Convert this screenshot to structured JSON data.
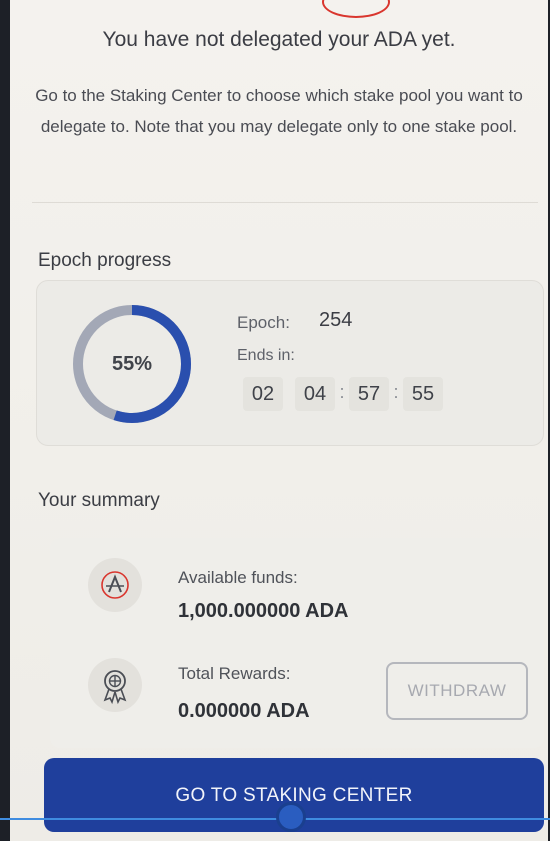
{
  "notice": {
    "title": "You have not delegated your ADA yet.",
    "body": "Go to the Staking Center to choose which stake pool you want to delegate to. Note that you may delegate only to one stake pool."
  },
  "epoch_progress": {
    "title": "Epoch progress",
    "percent_label": "55%",
    "percent_value": 55,
    "epoch_label": "Epoch:",
    "epoch_value": "254",
    "ends_label": "Ends in:",
    "countdown": [
      "02",
      "04",
      "57",
      "55"
    ],
    "separator": ":"
  },
  "summary": {
    "title": "Your summary",
    "available_label": "Available funds:",
    "available_value": "1,000.000000 ADA",
    "rewards_label": "Total Rewards:",
    "rewards_value": "0.000000 ADA",
    "withdraw_label": "WITHDRAW"
  },
  "staking_button": "GO TO STAKING CENTER",
  "icons": {
    "ada": "ada-coin-icon",
    "rewards": "award-ribbon-icon"
  },
  "colors": {
    "ring_fill": "#2a4fae",
    "ring_track": "#a3a8b6",
    "primary_button": "#1f3f9c",
    "slider": "#3f8ce0",
    "ada_icon": "#d9362e"
  }
}
